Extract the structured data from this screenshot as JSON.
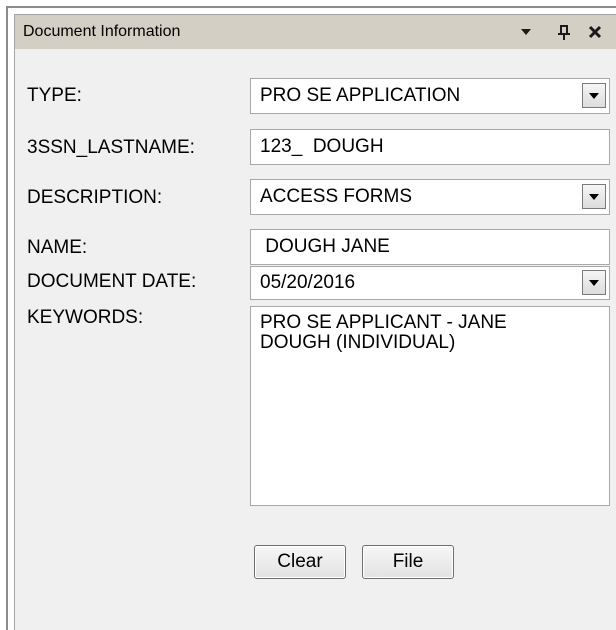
{
  "panel": {
    "title": "Document Information"
  },
  "fields": {
    "type": {
      "label": "TYPE:",
      "value": "PRO SE APPLICATION"
    },
    "ssn_lastname": {
      "label": "3SSN_LASTNAME:",
      "value": "123_  DOUGH"
    },
    "description": {
      "label": "DESCRIPTION:",
      "value": "ACCESS FORMS"
    },
    "name": {
      "label": "NAME:",
      "value": " DOUGH JANE"
    },
    "document_date": {
      "label": "DOCUMENT DATE:",
      "value": "05/20/2016"
    },
    "keywords": {
      "label": "KEYWORDS:",
      "value": "PRO SE APPLICANT - JANE\nDOUGH (INDIVIDUAL)"
    }
  },
  "buttons": {
    "clear": "Clear",
    "file": "File"
  }
}
